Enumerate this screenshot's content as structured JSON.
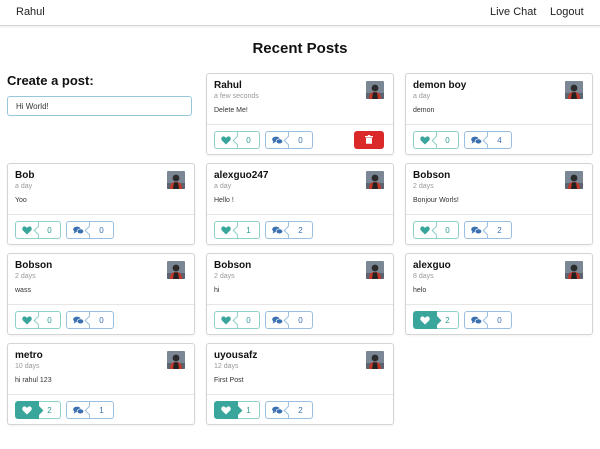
{
  "nav": {
    "brand": "Rahul",
    "live_chat": "Live Chat",
    "logout": "Logout"
  },
  "page_title": "Recent Posts",
  "create": {
    "title": "Create a post:",
    "input_value": "Hi World!"
  },
  "colors": {
    "like": "#3aa69b",
    "comment": "#3a6fb0",
    "delete": "#db2828"
  },
  "posts": [
    {
      "author": "Rahul",
      "time": "a few seconds",
      "content": "Delete Me!",
      "likes": "0",
      "comments": "0",
      "liked": false,
      "deletable": true
    },
    {
      "author": "demon boy",
      "time": "a day",
      "content": "demon",
      "likes": "0",
      "comments": "4",
      "liked": false,
      "deletable": false
    },
    {
      "author": "Bob",
      "time": "a day",
      "content": "Yoo",
      "likes": "0",
      "comments": "0",
      "liked": false,
      "deletable": false
    },
    {
      "author": "alexguo247",
      "time": "a day",
      "content": "Hello !",
      "likes": "1",
      "comments": "2",
      "liked": false,
      "deletable": false
    },
    {
      "author": "Bobson",
      "time": "2 days",
      "content": "Bonjour Worls!",
      "likes": "0",
      "comments": "2",
      "liked": false,
      "deletable": false
    },
    {
      "author": "Bobson",
      "time": "2 days",
      "content": "wass",
      "likes": "0",
      "comments": "0",
      "liked": false,
      "deletable": false
    },
    {
      "author": "Bobson",
      "time": "2 days",
      "content": "hi",
      "likes": "0",
      "comments": "0",
      "liked": false,
      "deletable": false
    },
    {
      "author": "alexguo",
      "time": "8 days",
      "content": "helo",
      "likes": "2",
      "comments": "0",
      "liked": true,
      "deletable": false
    },
    {
      "author": "metro",
      "time": "10 days",
      "content": "hi rahul 123",
      "likes": "2",
      "comments": "1",
      "liked": true,
      "deletable": false
    },
    {
      "author": "uyousafz",
      "time": "12 days",
      "content": "First Post",
      "likes": "1",
      "comments": "2",
      "liked": true,
      "deletable": false
    }
  ]
}
